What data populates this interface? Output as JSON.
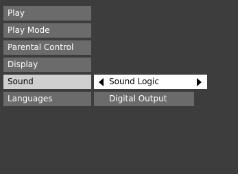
{
  "menu": {
    "items": [
      {
        "label": "Play"
      },
      {
        "label": "Play Mode"
      },
      {
        "label": "Parental Control"
      },
      {
        "label": "Display"
      },
      {
        "label": "Sound",
        "selected": true
      },
      {
        "label": "Languages"
      }
    ]
  },
  "submenu": {
    "items": [
      {
        "label": "Sound Logic",
        "highlighted": true
      },
      {
        "label": "Digital Output"
      }
    ]
  },
  "colors": {
    "background": "#3d3d3d",
    "item": "#6b6b6b",
    "selected": "#cfcfcf",
    "highlight": "#ffffff",
    "text": "#ffffff"
  }
}
